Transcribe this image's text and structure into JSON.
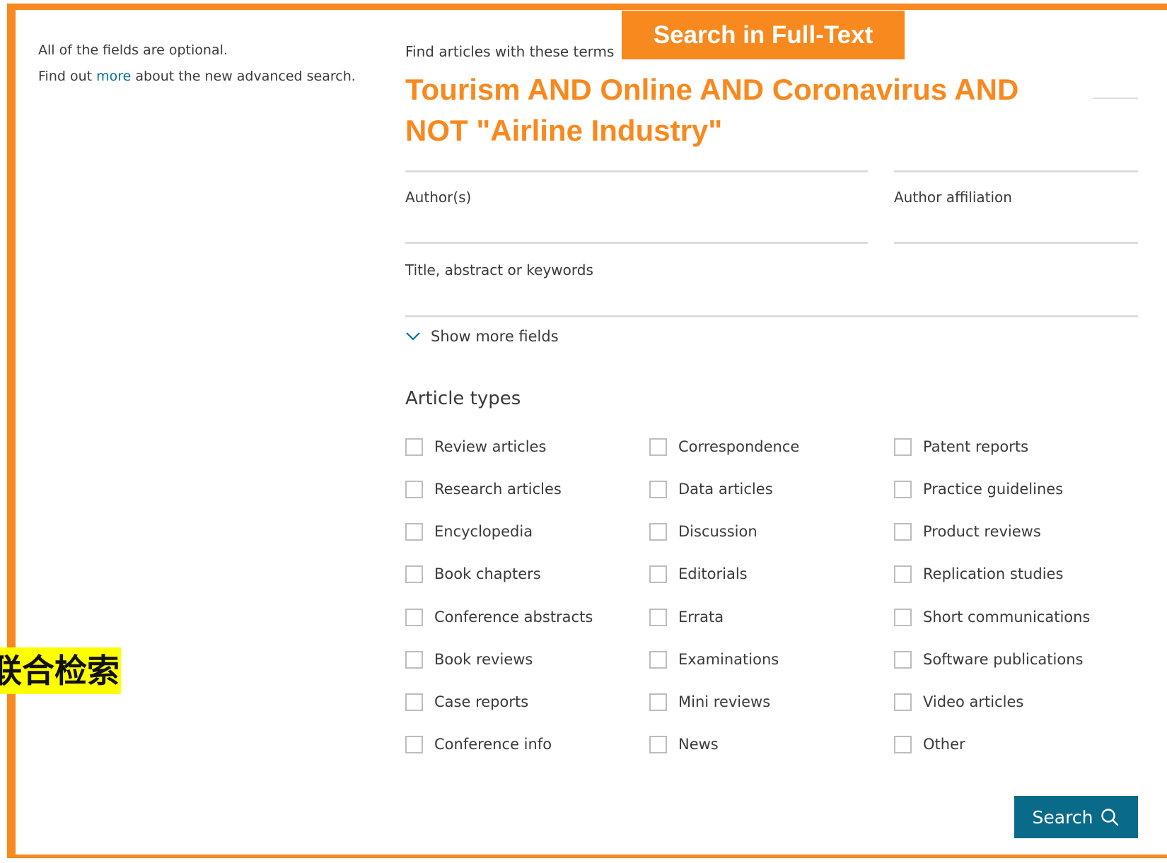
{
  "side_note": {
    "line1": "All of the fields are optional.",
    "line2_before": "Find out ",
    "line2_link": "more",
    "line2_after": " about the new advanced search."
  },
  "banner": {
    "text": "Search in Full-Text"
  },
  "fields": {
    "terms_label": "Find articles with these terms",
    "terms_value_line1": "Tourism AND Online AND Coronavirus AND",
    "terms_value_line2": "NOT \"Airline Industry\"",
    "authors_label": "Author(s)",
    "affiliation_label": "Author affiliation",
    "title_label": "Title, abstract or keywords"
  },
  "show_more": {
    "label": "Show more fields",
    "icon": "chevron-down-icon"
  },
  "article_types": {
    "title": "Article types",
    "columns": [
      [
        "Review articles",
        "Research articles",
        "Encyclopedia",
        "Book chapters",
        "Conference abstracts",
        "Book reviews",
        "Case reports",
        "Conference info"
      ],
      [
        "Correspondence",
        "Data articles",
        "Discussion",
        "Editorials",
        "Errata",
        "Examinations",
        "Mini reviews",
        "News"
      ],
      [
        "Patent reports",
        "Practice guidelines",
        "Product reviews",
        "Replication studies",
        "Short communications",
        "Software publications",
        "Video articles",
        "Other"
      ]
    ]
  },
  "search_button": {
    "label": "Search",
    "icon": "search-icon"
  },
  "annotation": {
    "text": "联合检索"
  },
  "colors": {
    "accent": "#f7891e",
    "button": "#0a6a8a",
    "link": "#007398",
    "highlight": "#ffff00"
  }
}
